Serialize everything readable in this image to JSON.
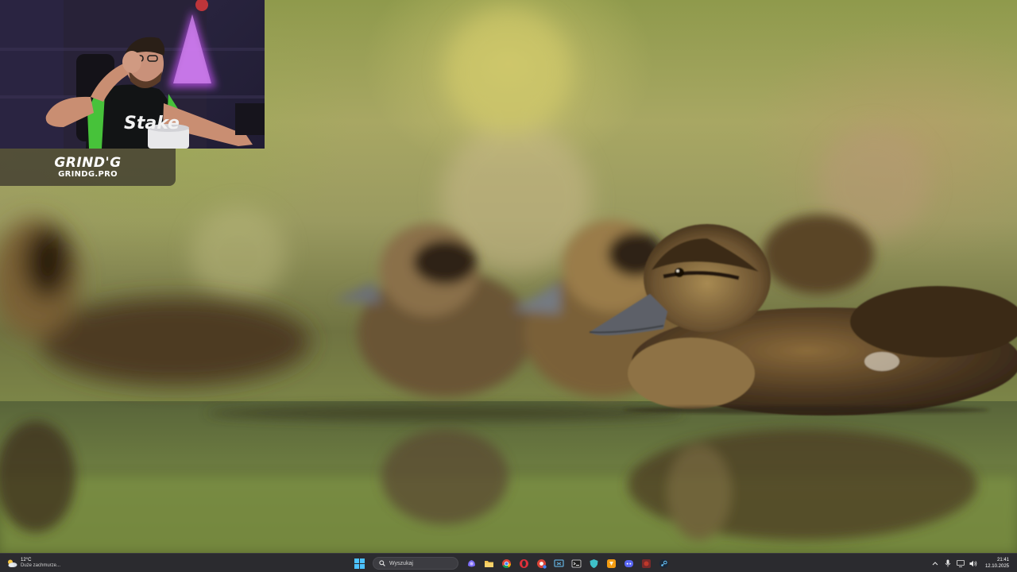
{
  "stream_overlay": {
    "brand": "GRIND'G",
    "site": "GRINDG.PRO",
    "jersey_text": "Stake"
  },
  "taskbar": {
    "weather": {
      "temperature": "12°C",
      "description": "Duże zachmurze...",
      "icon": "partly-cloudy-icon"
    },
    "search": {
      "label": "Wyszukaj",
      "icon": "search-icon"
    },
    "apps": [
      {
        "name": "copilot",
        "color": "#7b6cf6"
      },
      {
        "name": "file-explorer",
        "color": "#f2c14e"
      },
      {
        "name": "chrome",
        "color": "#4caf50"
      },
      {
        "name": "opera",
        "color": "#e0303a"
      },
      {
        "name": "chrome-alt",
        "color": "#db4437"
      },
      {
        "name": "app-blue",
        "color": "#5fa8d3"
      },
      {
        "name": "terminal",
        "color": "#e8e8e8"
      },
      {
        "name": "shield-app",
        "color": "#3fc1c9"
      },
      {
        "name": "orange-app",
        "color": "#f39c12"
      },
      {
        "name": "discord",
        "color": "#5865f2"
      },
      {
        "name": "game-app",
        "color": "#c0392b"
      },
      {
        "name": "steam",
        "color": "#66c0f4"
      }
    ],
    "tray": {
      "icons": [
        "chevron-up-icon",
        "microphone-icon",
        "network-icon",
        "volume-icon"
      ],
      "time": "21:41",
      "date": "12.10.2025"
    }
  }
}
